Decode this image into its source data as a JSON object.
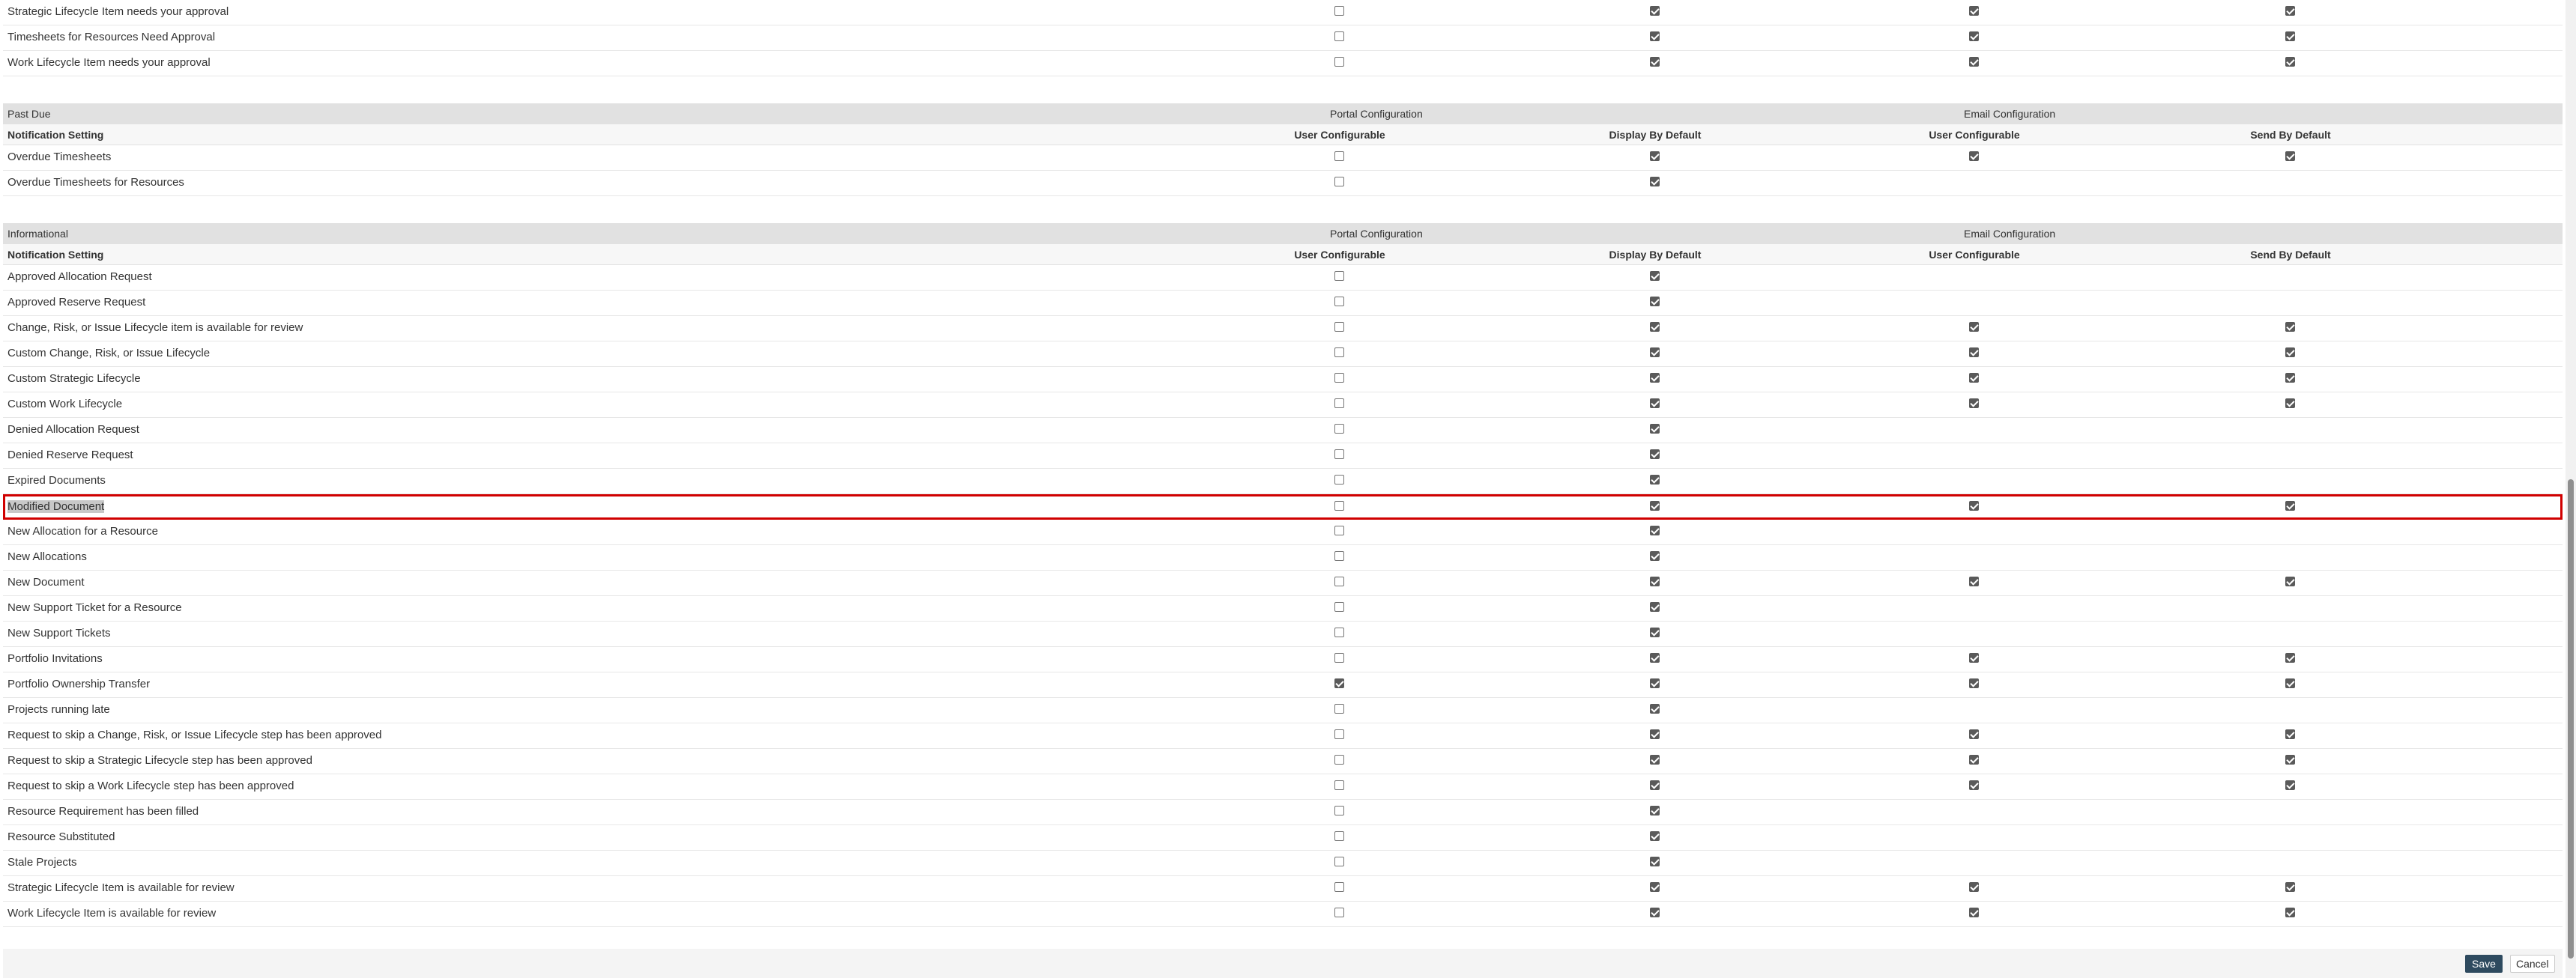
{
  "tail_rows": [
    {
      "name": "Strategic Lifecycle Item needs your approval",
      "portal_user": false,
      "portal_display": true,
      "email_user": true,
      "email_send": true
    },
    {
      "name": "Timesheets for Resources Need Approval",
      "portal_user": false,
      "portal_display": true,
      "email_user": true,
      "email_send": true
    },
    {
      "name": "Work Lifecycle Item needs your approval",
      "portal_user": false,
      "portal_display": true,
      "email_user": true,
      "email_send": true
    }
  ],
  "column_headers": {
    "setting": "Notification Setting",
    "portal_group": "Portal Configuration",
    "email_group": "Email Configuration",
    "user_configurable": "User Configurable",
    "display_by_default": "Display By Default",
    "send_by_default": "Send By Default"
  },
  "sections": [
    {
      "title": "Past Due",
      "rows": [
        {
          "name": "Overdue Timesheets",
          "portal_user": false,
          "portal_display": true,
          "email_user": true,
          "email_send": true
        },
        {
          "name": "Overdue Timesheets for Resources",
          "portal_user": false,
          "portal_display": true,
          "email_user": null,
          "email_send": null
        }
      ]
    },
    {
      "title": "Informational",
      "rows": [
        {
          "name": "Approved Allocation Request",
          "portal_user": false,
          "portal_display": true,
          "email_user": null,
          "email_send": null
        },
        {
          "name": "Approved Reserve Request",
          "portal_user": false,
          "portal_display": true,
          "email_user": null,
          "email_send": null
        },
        {
          "name": "Change, Risk, or Issue Lifecycle item is available for review",
          "portal_user": false,
          "portal_display": true,
          "email_user": true,
          "email_send": true
        },
        {
          "name": "Custom Change, Risk, or Issue Lifecycle",
          "portal_user": false,
          "portal_display": true,
          "email_user": true,
          "email_send": true
        },
        {
          "name": "Custom Strategic Lifecycle",
          "portal_user": false,
          "portal_display": true,
          "email_user": true,
          "email_send": true
        },
        {
          "name": "Custom Work Lifecycle",
          "portal_user": false,
          "portal_display": true,
          "email_user": true,
          "email_send": true
        },
        {
          "name": "Denied Allocation Request",
          "portal_user": false,
          "portal_display": true,
          "email_user": null,
          "email_send": null
        },
        {
          "name": "Denied Reserve Request",
          "portal_user": false,
          "portal_display": true,
          "email_user": null,
          "email_send": null
        },
        {
          "name": "Expired Documents",
          "portal_user": false,
          "portal_display": true,
          "email_user": null,
          "email_send": null
        },
        {
          "name": "Modified Document",
          "portal_user": false,
          "portal_display": true,
          "email_user": true,
          "email_send": true,
          "highlighted": true
        },
        {
          "name": "New Allocation for a Resource",
          "portal_user": false,
          "portal_display": true,
          "email_user": null,
          "email_send": null
        },
        {
          "name": "New Allocations",
          "portal_user": false,
          "portal_display": true,
          "email_user": null,
          "email_send": null
        },
        {
          "name": "New Document",
          "portal_user": false,
          "portal_display": true,
          "email_user": true,
          "email_send": true
        },
        {
          "name": "New Support Ticket for a Resource",
          "portal_user": false,
          "portal_display": true,
          "email_user": null,
          "email_send": null
        },
        {
          "name": "New Support Tickets",
          "portal_user": false,
          "portal_display": true,
          "email_user": null,
          "email_send": null
        },
        {
          "name": "Portfolio Invitations",
          "portal_user": false,
          "portal_display": true,
          "email_user": true,
          "email_send": true
        },
        {
          "name": "Portfolio Ownership Transfer",
          "portal_user": true,
          "portal_display": true,
          "email_user": true,
          "email_send": true
        },
        {
          "name": "Projects running late",
          "portal_user": false,
          "portal_display": true,
          "email_user": null,
          "email_send": null
        },
        {
          "name": "Request to skip a Change, Risk, or Issue Lifecycle step has been approved",
          "portal_user": false,
          "portal_display": true,
          "email_user": true,
          "email_send": true
        },
        {
          "name": "Request to skip a Strategic Lifecycle step has been approved",
          "portal_user": false,
          "portal_display": true,
          "email_user": true,
          "email_send": true
        },
        {
          "name": "Request to skip a Work Lifecycle step has been approved",
          "portal_user": false,
          "portal_display": true,
          "email_user": true,
          "email_send": true
        },
        {
          "name": "Resource Requirement has been filled",
          "portal_user": false,
          "portal_display": true,
          "email_user": null,
          "email_send": null
        },
        {
          "name": "Resource Substituted",
          "portal_user": false,
          "portal_display": true,
          "email_user": null,
          "email_send": null
        },
        {
          "name": "Stale Projects",
          "portal_user": false,
          "portal_display": true,
          "email_user": null,
          "email_send": null
        },
        {
          "name": "Strategic Lifecycle Item is available for review",
          "portal_user": false,
          "portal_display": true,
          "email_user": true,
          "email_send": true
        },
        {
          "name": "Work Lifecycle Item is available for review",
          "portal_user": false,
          "portal_display": true,
          "email_user": true,
          "email_send": true
        }
      ]
    }
  ],
  "footer": {
    "save_label": "Save",
    "cancel_label": "Cancel"
  },
  "colors": {
    "save_button": "#2e4a5f",
    "highlight_border": "#d00000",
    "section_header": "#e1e1e1"
  }
}
